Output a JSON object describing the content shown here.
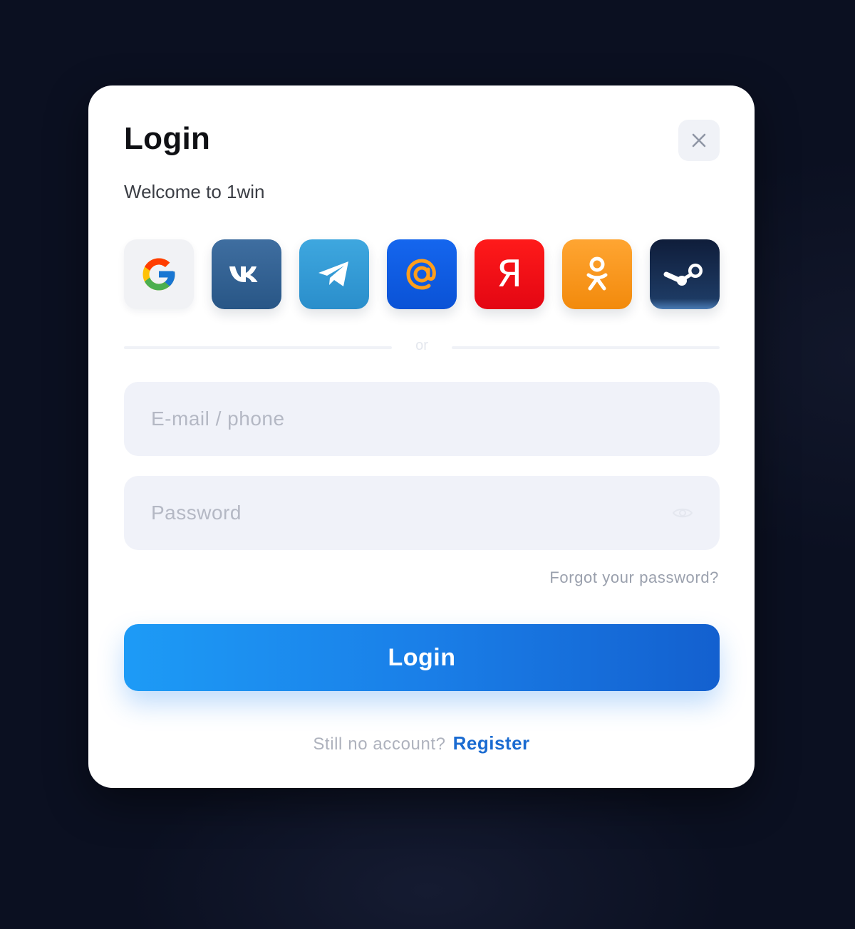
{
  "modal": {
    "title": "Login",
    "subtitle": "Welcome to 1win",
    "close_icon": "close-icon"
  },
  "social": [
    {
      "name": "google",
      "icon": "google-icon",
      "color": "#f1f2f5"
    },
    {
      "name": "vk",
      "icon": "vk-icon",
      "color": "#33639a"
    },
    {
      "name": "telegram",
      "icon": "telegram-icon",
      "color": "#35a0da"
    },
    {
      "name": "mailru",
      "icon": "mailru-icon",
      "color": "#105de4"
    },
    {
      "name": "yandex",
      "icon": "yandex-icon",
      "glyph": "Я",
      "color": "#f50f15"
    },
    {
      "name": "odnoklassniki",
      "icon": "odnoklassniki-icon",
      "color": "#f89a20"
    },
    {
      "name": "steam",
      "icon": "steam-icon",
      "color": "#142a4d"
    }
  ],
  "divider": {
    "text": "or"
  },
  "form": {
    "email_placeholder": "E-mail / phone",
    "email_value": "",
    "password_placeholder": "Password",
    "password_value": "",
    "password_toggle_icon": "eye-icon",
    "forgot_label": "Forgot your password?",
    "submit_label": "Login"
  },
  "footer": {
    "prompt": "Still no account?",
    "register_label": "Register"
  },
  "colors": {
    "backdrop": "#0b1021",
    "accent": "#1a7fe8",
    "link": "#1a6bd1"
  }
}
